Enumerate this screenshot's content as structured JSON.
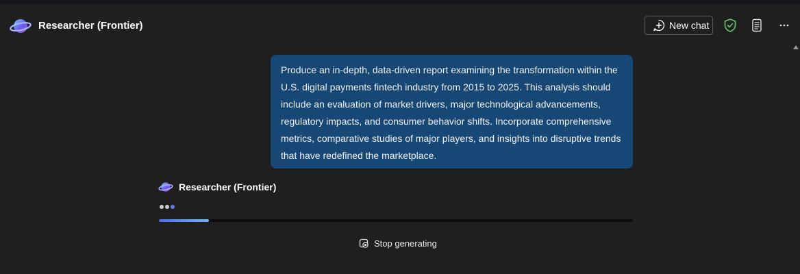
{
  "app": {
    "title": "Researcher (Frontier)"
  },
  "header": {
    "new_chat_label": "New chat"
  },
  "conversation": {
    "user_message": "Produce an in-depth, data-driven report examining the transformation within the U.S. digital payments fintech industry from 2015 to 2025. This analysis should include an evaluation of market drivers, major technological advancements, regulatory impacts, and consumer behavior shifts. Incorporate comprehensive metrics, comparative studies of major players, and insights into disruptive trends that have redefined the marketplace.",
    "responder_name": "Researcher (Frontier)",
    "progress_fraction": 0.105,
    "stop_label": "Stop generating"
  },
  "icons": {
    "logo": "researcher-planet-icon",
    "new_chat": "chat-add-icon",
    "shield": "shield-check-icon",
    "doc": "document-icon",
    "more": "more-horizontal-icon",
    "stop": "stop-icon"
  },
  "colors": {
    "background": "#1f1f1f",
    "user_bubble": "#174774",
    "shield_green": "#6cc76c",
    "progress_start": "#4f6bed",
    "progress_end": "#6fb5ef"
  }
}
